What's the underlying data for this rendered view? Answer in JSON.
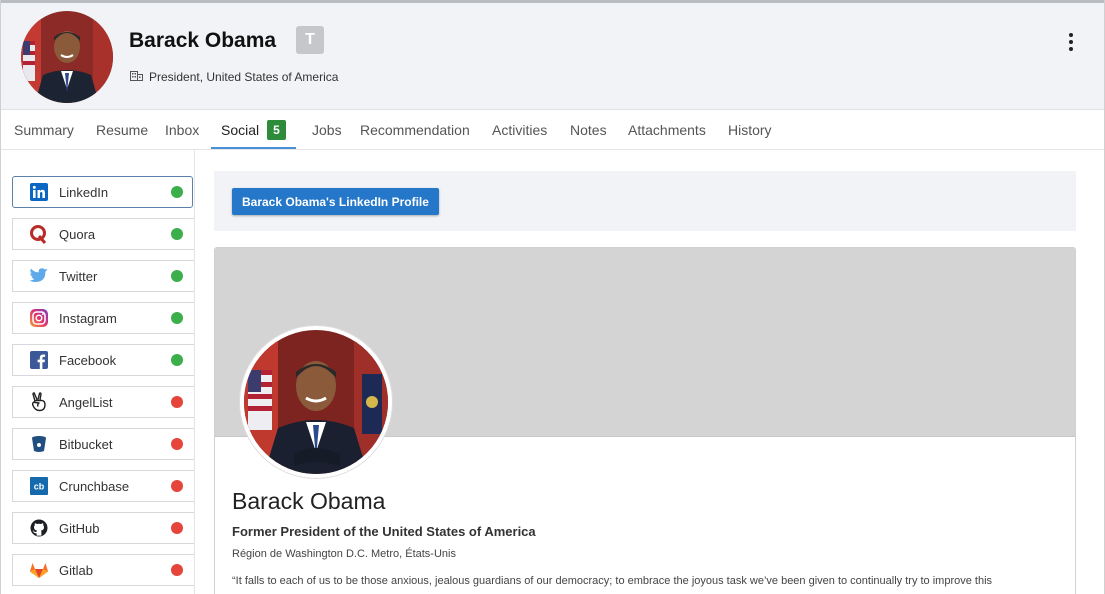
{
  "header": {
    "name": "Barack Obama",
    "badge": "T",
    "title": "President, United States of America"
  },
  "tabs": [
    {
      "label": "Summary"
    },
    {
      "label": "Resume"
    },
    {
      "label": "Inbox"
    },
    {
      "label": "Social",
      "count": "5",
      "active": true
    },
    {
      "label": "Jobs"
    },
    {
      "label": "Recommendation"
    },
    {
      "label": "Activities"
    },
    {
      "label": "Notes"
    },
    {
      "label": "Attachments"
    },
    {
      "label": "History"
    }
  ],
  "networks": [
    {
      "label": "LinkedIn",
      "icon": "linkedin-icon",
      "status": "connected",
      "color": "#3cae4b"
    },
    {
      "label": "Quora",
      "icon": "quora-icon",
      "status": "connected",
      "color": "#3cae4b"
    },
    {
      "label": "Twitter",
      "icon": "twitter-icon",
      "status": "connected",
      "color": "#3cae4b"
    },
    {
      "label": "Instagram",
      "icon": "instagram-icon",
      "status": "connected",
      "color": "#3cae4b"
    },
    {
      "label": "Facebook",
      "icon": "facebook-icon",
      "status": "connected",
      "color": "#3cae4b"
    },
    {
      "label": "AngelList",
      "icon": "angellist-icon",
      "status": "missing",
      "color": "#e5453a"
    },
    {
      "label": "Bitbucket",
      "icon": "bitbucket-icon",
      "status": "missing",
      "color": "#e5453a"
    },
    {
      "label": "Crunchbase",
      "icon": "crunchbase-icon",
      "status": "missing",
      "color": "#e5453a"
    },
    {
      "label": "GitHub",
      "icon": "github-icon",
      "status": "missing",
      "color": "#e5453a"
    },
    {
      "label": "Gitlab",
      "icon": "gitlab-icon",
      "status": "missing",
      "color": "#e5453a"
    }
  ],
  "profile": {
    "button_label": "Barack Obama's LinkedIn Profile",
    "name": "Barack Obama",
    "headline": "Former President of the United States of America",
    "location": "Région de Washington D.C. Metro, États-Unis",
    "quote": "“It falls to each of us to be those anxious, jealous guardians of our democracy; to embrace the joyous task we’ve been given to continually try to improve this"
  },
  "colors": {
    "accent": "#2477c9",
    "tab_count_bg": "#2e8b3a",
    "connected": "#3cae4b",
    "missing": "#e5453a"
  }
}
